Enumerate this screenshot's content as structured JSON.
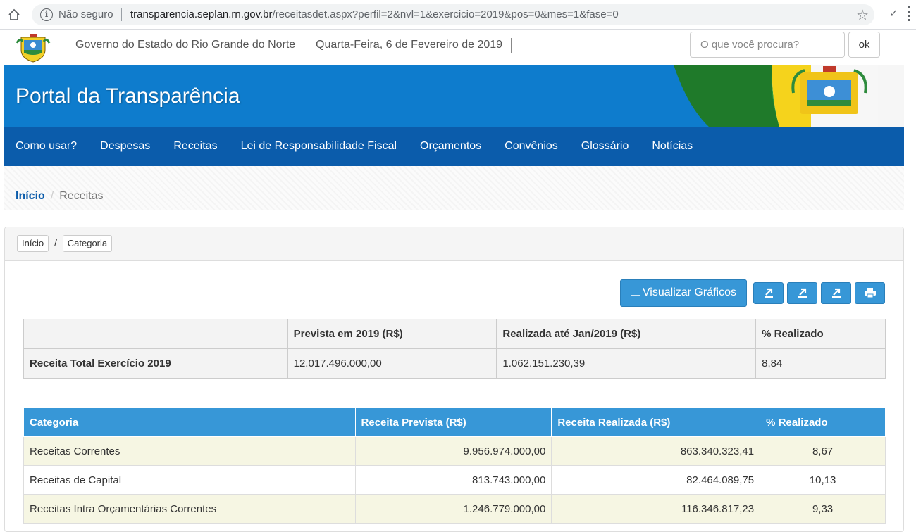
{
  "browser": {
    "security_label": "Não seguro",
    "url_host": "transparencia.seplan.rn.gov.br",
    "url_path": "/receitasdet.aspx?perfil=2&nvl=1&exercicio=2019&pos=0&mes=1&fase=0"
  },
  "header": {
    "government": "Governo do Estado do Rio Grande do Norte",
    "date": "Quarta-Feira, 6 de Fevereiro de 2019",
    "search_placeholder": "O que você procura?",
    "search_button": "ok"
  },
  "banner": {
    "title": "Portal da Transparência"
  },
  "nav": {
    "items": [
      "Como usar?",
      "Despesas",
      "Receitas",
      "Lei de Responsabilidade Fiscal",
      "Orçamentos",
      "Convênios",
      "Glossário",
      "Notícias"
    ]
  },
  "breadcrumb": {
    "home": "Início",
    "current": "Receitas"
  },
  "panel": {
    "crumbs": [
      "Início",
      "Categoria"
    ],
    "separator": "/",
    "graph_button": "Visualizar Gráficos",
    "colors": {
      "primary": "#3797d7",
      "nav": "#0b5cab",
      "banner": "#0e7ccd"
    }
  },
  "summary": {
    "headers": [
      "",
      "Prevista em 2019 (R$)",
      "Realizada até Jan/2019 (R$)",
      "% Realizado"
    ],
    "row": [
      "Receita Total Exercício 2019",
      "12.017.496.000,00",
      "1.062.151.230,39",
      "8,84"
    ]
  },
  "categories": {
    "headers": [
      "Categoria",
      "Receita Prevista (R$)",
      "Receita Realizada (R$)",
      "% Realizado"
    ],
    "rows": [
      [
        "Receitas Correntes",
        "9.956.974.000,00",
        "863.340.323,41",
        "8,67"
      ],
      [
        "Receitas de Capital",
        "813.743.000,00",
        "82.464.089,75",
        "10,13"
      ],
      [
        "Receitas Intra Orçamentárias Correntes",
        "1.246.779.000,00",
        "116.346.817,23",
        "9,33"
      ]
    ]
  }
}
